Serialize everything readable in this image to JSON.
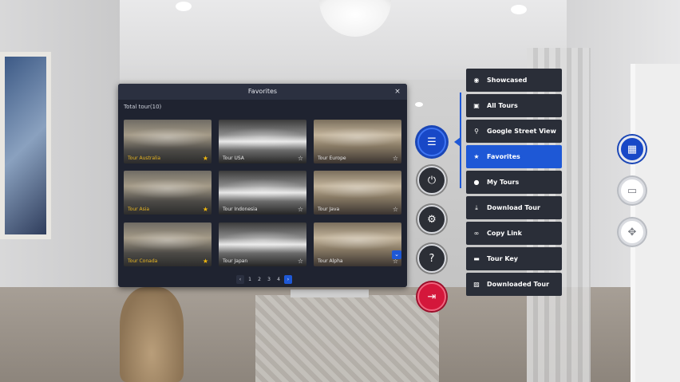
{
  "panel": {
    "title": "Favorites",
    "close_glyph": "×",
    "count_text": "Total tour(10)",
    "scroll_glyph": "⌄",
    "tours": [
      {
        "name": "Tour Australia",
        "favorite": true
      },
      {
        "name": "Tour USA",
        "favorite": false
      },
      {
        "name": "Tour Europe",
        "favorite": false
      },
      {
        "name": "Tour Asia",
        "favorite": true
      },
      {
        "name": "Tour Indonesia",
        "favorite": false
      },
      {
        "name": "Tour Java",
        "favorite": false
      },
      {
        "name": "Tour Conada",
        "favorite": true
      },
      {
        "name": "Tour Japan",
        "favorite": false
      },
      {
        "name": "Tour Alpha",
        "favorite": false
      }
    ],
    "pagination": {
      "prev": "‹",
      "pages": [
        "1",
        "2",
        "3",
        "4"
      ],
      "next": "›"
    }
  },
  "menu": {
    "items": [
      {
        "label": "Showcased",
        "icon": "eye-icon",
        "glyph": "◉"
      },
      {
        "label": "All Tours",
        "icon": "images-icon",
        "glyph": "▣"
      },
      {
        "label": "Google Street View",
        "icon": "street-view-icon",
        "glyph": "⚲"
      },
      {
        "label": "Favorites",
        "icon": "star-icon",
        "glyph": "★"
      },
      {
        "label": "My Tours",
        "icon": "user-icon",
        "glyph": "●"
      },
      {
        "label": "Download Tour",
        "icon": "download-icon",
        "glyph": "⤓"
      },
      {
        "label": "Copy Link",
        "icon": "link-icon",
        "glyph": "∞"
      },
      {
        "label": "Tour Key",
        "icon": "key-card-icon",
        "glyph": "▬"
      },
      {
        "label": "Downloaded Tour",
        "icon": "image-icon",
        "glyph": "▨"
      }
    ],
    "active_index": 3
  },
  "controls": {
    "list_glyph": "☰",
    "plug_glyph": "⏻",
    "settings_glyph": "⚙",
    "help_glyph": "?",
    "exit_glyph": "⇥",
    "gallery_glyph": "▦",
    "vr_glyph": "▭",
    "move_glyph": "✥"
  },
  "colors": {
    "accent": "#1e58d6",
    "exit": "#d4173b",
    "favorite_star": "#f1b80e",
    "panel_bg": "#1f2330",
    "menu_bg": "#2a2e38"
  }
}
